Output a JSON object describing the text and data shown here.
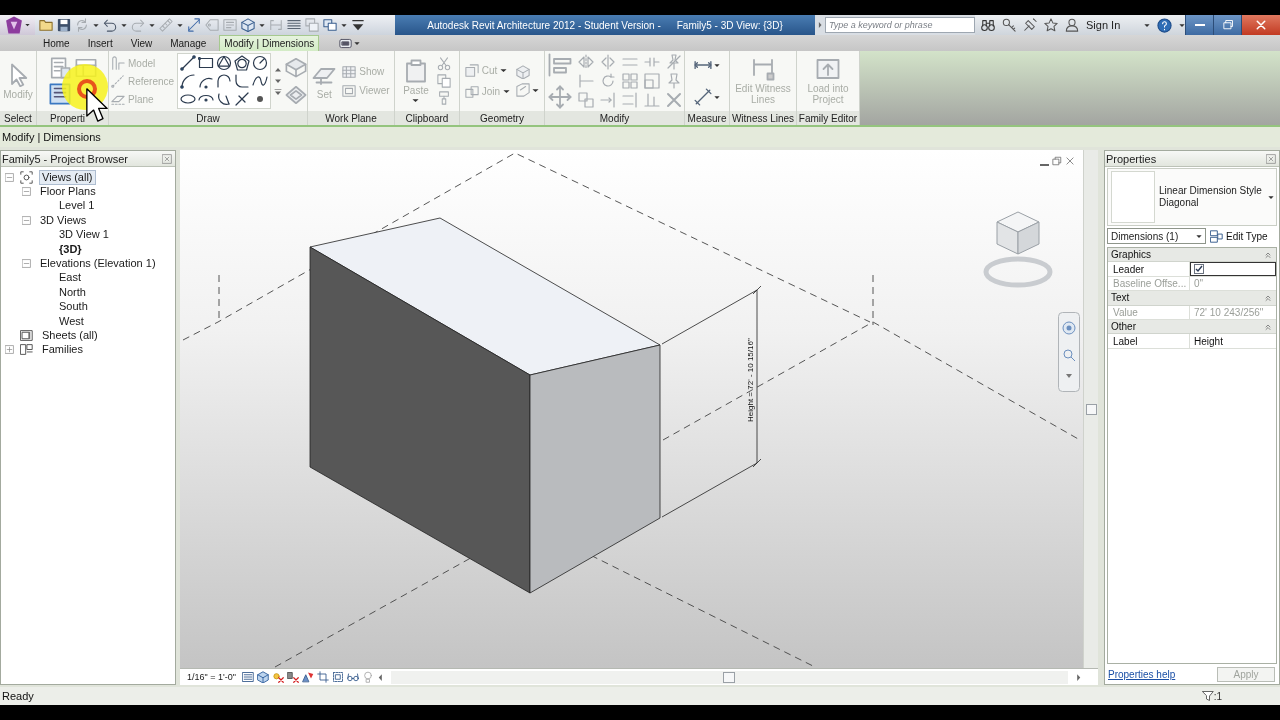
{
  "title_bar": {
    "title": "Autodesk Revit Architecture 2012 - Student Version -",
    "document": "Family5 - 3D View: {3D}",
    "search": {
      "placeholder": "Type a keyword or phrase"
    },
    "sign_in": "Sign In"
  },
  "tabs": [
    {
      "label": "Home",
      "selected": false
    },
    {
      "label": "Insert",
      "selected": false
    },
    {
      "label": "View",
      "selected": false
    },
    {
      "label": "Manage",
      "selected": false
    },
    {
      "label": "Modify | Dimensions",
      "selected": true
    }
  ],
  "ribbon": {
    "panels": [
      {
        "kind": "select",
        "label": "Select",
        "tools": [
          {
            "label": "Modify",
            "disabled": true
          }
        ]
      },
      {
        "kind": "properties",
        "label": "Properti"
      },
      {
        "kind": "draw",
        "label": "Draw",
        "tools": [
          {
            "label": "Model",
            "disabled": true
          },
          {
            "label": "Reference",
            "disabled": true
          },
          {
            "label": "Plane",
            "disabled": true
          }
        ]
      },
      {
        "kind": "work-plane",
        "label": "Work Plane",
        "tools": [
          {
            "label": "Set",
            "disabled": true
          },
          {
            "label": "Show",
            "disabled": true
          },
          {
            "label": "Viewer",
            "disabled": true
          }
        ]
      },
      {
        "kind": "clipboard",
        "label": "Clipboard",
        "tools": [
          {
            "label": "Paste",
            "disabled": true
          }
        ]
      },
      {
        "kind": "geometry",
        "label": "Geometry",
        "tools": [
          {
            "label": "Cut",
            "disabled": true
          },
          {
            "label": "Join",
            "disabled": true
          }
        ]
      },
      {
        "kind": "modify",
        "label": "Modify"
      },
      {
        "kind": "measure",
        "label": "Measure"
      },
      {
        "kind": "witness-lines",
        "label": "Witness Lines",
        "tools": [
          {
            "label": "Edit Witness Lines",
            "disabled": true
          }
        ]
      },
      {
        "kind": "family-editor",
        "label": "Family Editor",
        "tools": [
          {
            "label": "Load into Project",
            "disabled": true
          }
        ]
      }
    ]
  },
  "options_bar": {
    "label": "Modify | Dimensions"
  },
  "project_browser": {
    "title": "Family5 - Project Browser",
    "tree": [
      {
        "label": "Views (all)",
        "kind": "views",
        "expanded": true,
        "selected": true,
        "current": false,
        "children": [
          {
            "label": "Floor Plans",
            "kind": "group",
            "expanded": true,
            "selected": false,
            "current": false,
            "children": [
              {
                "label": "Level 1",
                "kind": "view",
                "selected": false,
                "current": false
              }
            ]
          },
          {
            "label": "3D Views",
            "kind": "group",
            "expanded": true,
            "selected": false,
            "current": false,
            "children": [
              {
                "label": "3D View 1",
                "kind": "view",
                "selected": false,
                "current": false
              },
              {
                "label": "{3D}",
                "kind": "view",
                "selected": false,
                "current": true
              }
            ]
          },
          {
            "label": "Elevations (Elevation 1)",
            "kind": "group",
            "expanded": true,
            "selected": false,
            "current": false,
            "children": [
              {
                "label": "East",
                "kind": "view",
                "selected": false,
                "current": false
              },
              {
                "label": "North",
                "kind": "view",
                "selected": false,
                "current": false
              },
              {
                "label": "South",
                "kind": "view",
                "selected": false,
                "current": false
              },
              {
                "label": "West",
                "kind": "view",
                "selected": false,
                "current": false
              }
            ]
          }
        ]
      },
      {
        "label": "Sheets (all)",
        "kind": "sheets",
        "selected": false,
        "current": false
      },
      {
        "label": "Families",
        "kind": "families",
        "expanded": false,
        "selected": false,
        "current": false
      }
    ]
  },
  "view": {
    "dimension_text": "Height = 72' - 10 15/16\"",
    "scale": "1/16\" = 1'-0\""
  },
  "properties": {
    "title": "Properties",
    "type_name": "Linear Dimension Style",
    "type_variant": "Diagonal",
    "selector": "Dimensions (1)",
    "edit_type": "Edit Type",
    "groups": [
      {
        "label": "Graphics",
        "rows": [
          {
            "label": "Leader",
            "kind": "checkbox",
            "checked": true,
            "selected": true,
            "disabled": false
          },
          {
            "label": "Baseline Offse...",
            "kind": "text",
            "value": "0\"",
            "selected": false,
            "disabled": true
          }
        ]
      },
      {
        "label": "Text",
        "rows": [
          {
            "label": "Value",
            "kind": "text",
            "value": "72' 10 243/256\"",
            "selected": false,
            "disabled": true
          }
        ]
      },
      {
        "label": "Other",
        "rows": [
          {
            "label": "Label",
            "kind": "text",
            "value": "Height",
            "selected": false,
            "disabled": false
          }
        ]
      }
    ],
    "help": "Properties help",
    "apply": {
      "label": "Apply",
      "disabled": true
    }
  },
  "status_bar": {
    "text": "Ready",
    "selection_count": ":1"
  }
}
